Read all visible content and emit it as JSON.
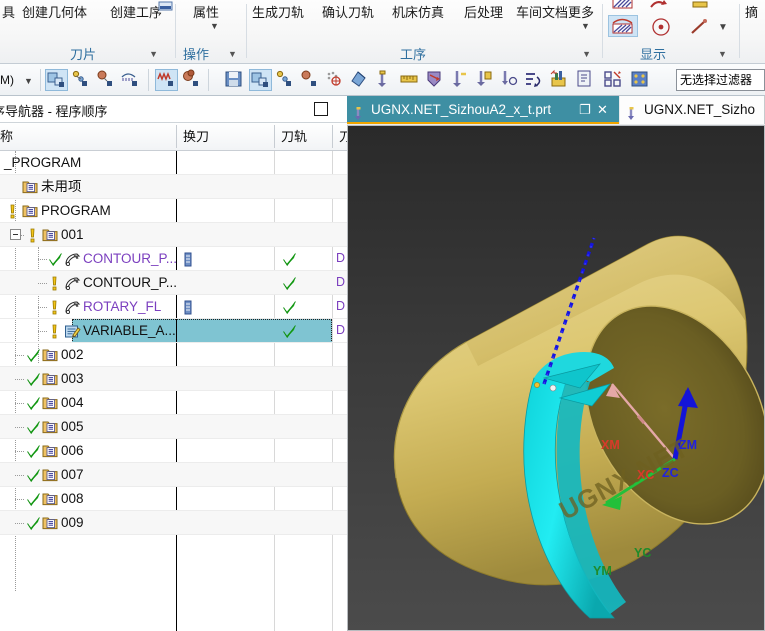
{
  "ribbon": {
    "groups": [
      {
        "name": "刀片",
        "label": "刀片",
        "commands": [
          "具",
          "创建几何体",
          "创建工序"
        ]
      },
      {
        "name": "操作",
        "label": "操作",
        "commands": [
          "属性"
        ]
      },
      {
        "name": "工序",
        "label": "工序",
        "commands": [
          "生成刀轨",
          "确认刀轨",
          "机床仿真",
          "后处理",
          "车间文档",
          "更多"
        ]
      },
      {
        "name": "显示",
        "label": "显示",
        "commands": []
      }
    ],
    "group_labels": {
      "blade": "刀片",
      "operation": "操作",
      "process": "工序",
      "display": "显示"
    },
    "commands": {
      "tool": "具",
      "create_geometry": "创建几何体",
      "create_operation": "创建工序",
      "properties": "属性",
      "generate_toolpath": "生成刀轨",
      "verify_toolpath": "确认刀轨",
      "machine_simulation": "机床仿真",
      "postprocess": "后处理",
      "shop_documentation": "车间文档",
      "more": "更多"
    }
  },
  "quickbar": {
    "mode_label": "M) ",
    "filter_value": "无选择过滤器",
    "icons": [
      "create-tool-icon",
      "create-geometry-icon",
      "create-method-icon",
      "create-program-icon",
      "generate-toolpath-icon",
      "verify-toolpath-icon",
      "save-icon",
      "create-operation-icon",
      "geometry-view-icon",
      "machine-tool-view-icon",
      "toolpath-display-icon",
      "simulate-icon",
      "reposition-icon",
      "tool-path-icon",
      "measure-icon",
      "analysis-icon",
      "transform-icon",
      "trim-icon",
      "divide-icon",
      "reorder-icon",
      "list-icon",
      "export-icon",
      "report-icon",
      "layout-icon",
      "grid-icon"
    ]
  },
  "navigator": {
    "title": "序导航器 - 程序顺序",
    "pin_icon": "maximize-icon",
    "columns": [
      "称",
      "换刀",
      "刀轨",
      "刀"
    ],
    "rows": [
      {
        "name": "_PROGRAM",
        "indent": 0,
        "icon": "none",
        "status": "none",
        "name_color": "black",
        "change_tool": "",
        "toolpath": "",
        "col4": "",
        "selected": false,
        "expander": "none"
      },
      {
        "name": "未用项",
        "indent": 0,
        "icon": "program-folder",
        "status": "none",
        "name_color": "black",
        "change_tool": "",
        "toolpath": "",
        "col4": "",
        "selected": false,
        "expander": "none"
      },
      {
        "name": "PROGRAM",
        "indent": 0,
        "icon": "program-folder",
        "status": "warning",
        "name_color": "black",
        "change_tool": "",
        "toolpath": "",
        "col4": "",
        "selected": false,
        "expander": "none"
      },
      {
        "name": "001",
        "indent": 1,
        "icon": "program-folder",
        "status": "warning",
        "name_color": "black",
        "change_tool": "",
        "toolpath": "",
        "col4": "",
        "selected": false,
        "expander": "collapse"
      },
      {
        "name": "CONTOUR_P...",
        "indent": 2,
        "icon": "operation",
        "status": "ok",
        "name_color": "purple",
        "change_tool": "tool-icon",
        "toolpath": "ok",
        "col4": "D",
        "selected": false,
        "expander": "none"
      },
      {
        "name": "CONTOUR_P...",
        "indent": 2,
        "icon": "operation",
        "status": "warning",
        "name_color": "black",
        "change_tool": "",
        "toolpath": "ok",
        "col4": "D",
        "selected": false,
        "expander": "none"
      },
      {
        "name": "ROTARY_FL",
        "indent": 2,
        "icon": "operation",
        "status": "warning",
        "name_color": "purple",
        "change_tool": "tool-icon",
        "toolpath": "ok",
        "col4": "D",
        "selected": false,
        "expander": "none"
      },
      {
        "name": "VARIABLE_A...",
        "indent": 2,
        "icon": "operation-edit",
        "status": "warning",
        "name_color": "black",
        "change_tool": "",
        "toolpath": "ok",
        "col4": "D",
        "selected": true,
        "expander": "none"
      },
      {
        "name": "002",
        "indent": 1,
        "icon": "program-folder",
        "status": "ok",
        "name_color": "black",
        "change_tool": "",
        "toolpath": "",
        "col4": "",
        "selected": false,
        "expander": "none"
      },
      {
        "name": "003",
        "indent": 1,
        "icon": "program-folder",
        "status": "ok",
        "name_color": "black",
        "change_tool": "",
        "toolpath": "",
        "col4": "",
        "selected": false,
        "expander": "none"
      },
      {
        "name": "004",
        "indent": 1,
        "icon": "program-folder",
        "status": "ok",
        "name_color": "black",
        "change_tool": "",
        "toolpath": "",
        "col4": "",
        "selected": false,
        "expander": "none"
      },
      {
        "name": "005",
        "indent": 1,
        "icon": "program-folder",
        "status": "ok",
        "name_color": "black",
        "change_tool": "",
        "toolpath": "",
        "col4": "",
        "selected": false,
        "expander": "none"
      },
      {
        "name": "006",
        "indent": 1,
        "icon": "program-folder",
        "status": "ok",
        "name_color": "black",
        "change_tool": "",
        "toolpath": "",
        "col4": "",
        "selected": false,
        "expander": "none"
      },
      {
        "name": "007",
        "indent": 1,
        "icon": "program-folder",
        "status": "ok",
        "name_color": "black",
        "change_tool": "",
        "toolpath": "",
        "col4": "",
        "selected": false,
        "expander": "none"
      },
      {
        "name": "008",
        "indent": 1,
        "icon": "program-folder",
        "status": "ok",
        "name_color": "black",
        "change_tool": "",
        "toolpath": "",
        "col4": "",
        "selected": false,
        "expander": "none"
      },
      {
        "name": "009",
        "indent": 1,
        "icon": "program-folder",
        "status": "ok",
        "name_color": "black",
        "change_tool": "",
        "toolpath": "",
        "col4": "",
        "selected": false,
        "expander": "none"
      }
    ]
  },
  "tabs": [
    {
      "label": "UGNX.NET_SizhouA2_x_t.prt",
      "active": true,
      "restore": "❐",
      "close": "✕"
    },
    {
      "label": "UGNX.NET_Sizho",
      "active": false,
      "restore": "",
      "close": ""
    }
  ],
  "viewport": {
    "watermark": "UGNX.NET",
    "csys_labels": [
      {
        "text": "XM",
        "color": "#d83a2a"
      },
      {
        "text": "XC",
        "color": "#d83a2a"
      },
      {
        "text": "ZM",
        "color": "#2222dd"
      },
      {
        "text": "ZC",
        "color": "#2222dd"
      },
      {
        "text": "YC",
        "color": "#1f8a2a"
      },
      {
        "text": "YM",
        "color": "#1f8a2a"
      }
    ],
    "colors": {
      "part": "#d9c46a",
      "part_dark": "#6e6020",
      "machined": "#19e0e6",
      "toolpath_rapid": "#1010dd",
      "background_top": "#2a2a2a",
      "background_bottom": "#4b4b4b"
    }
  }
}
